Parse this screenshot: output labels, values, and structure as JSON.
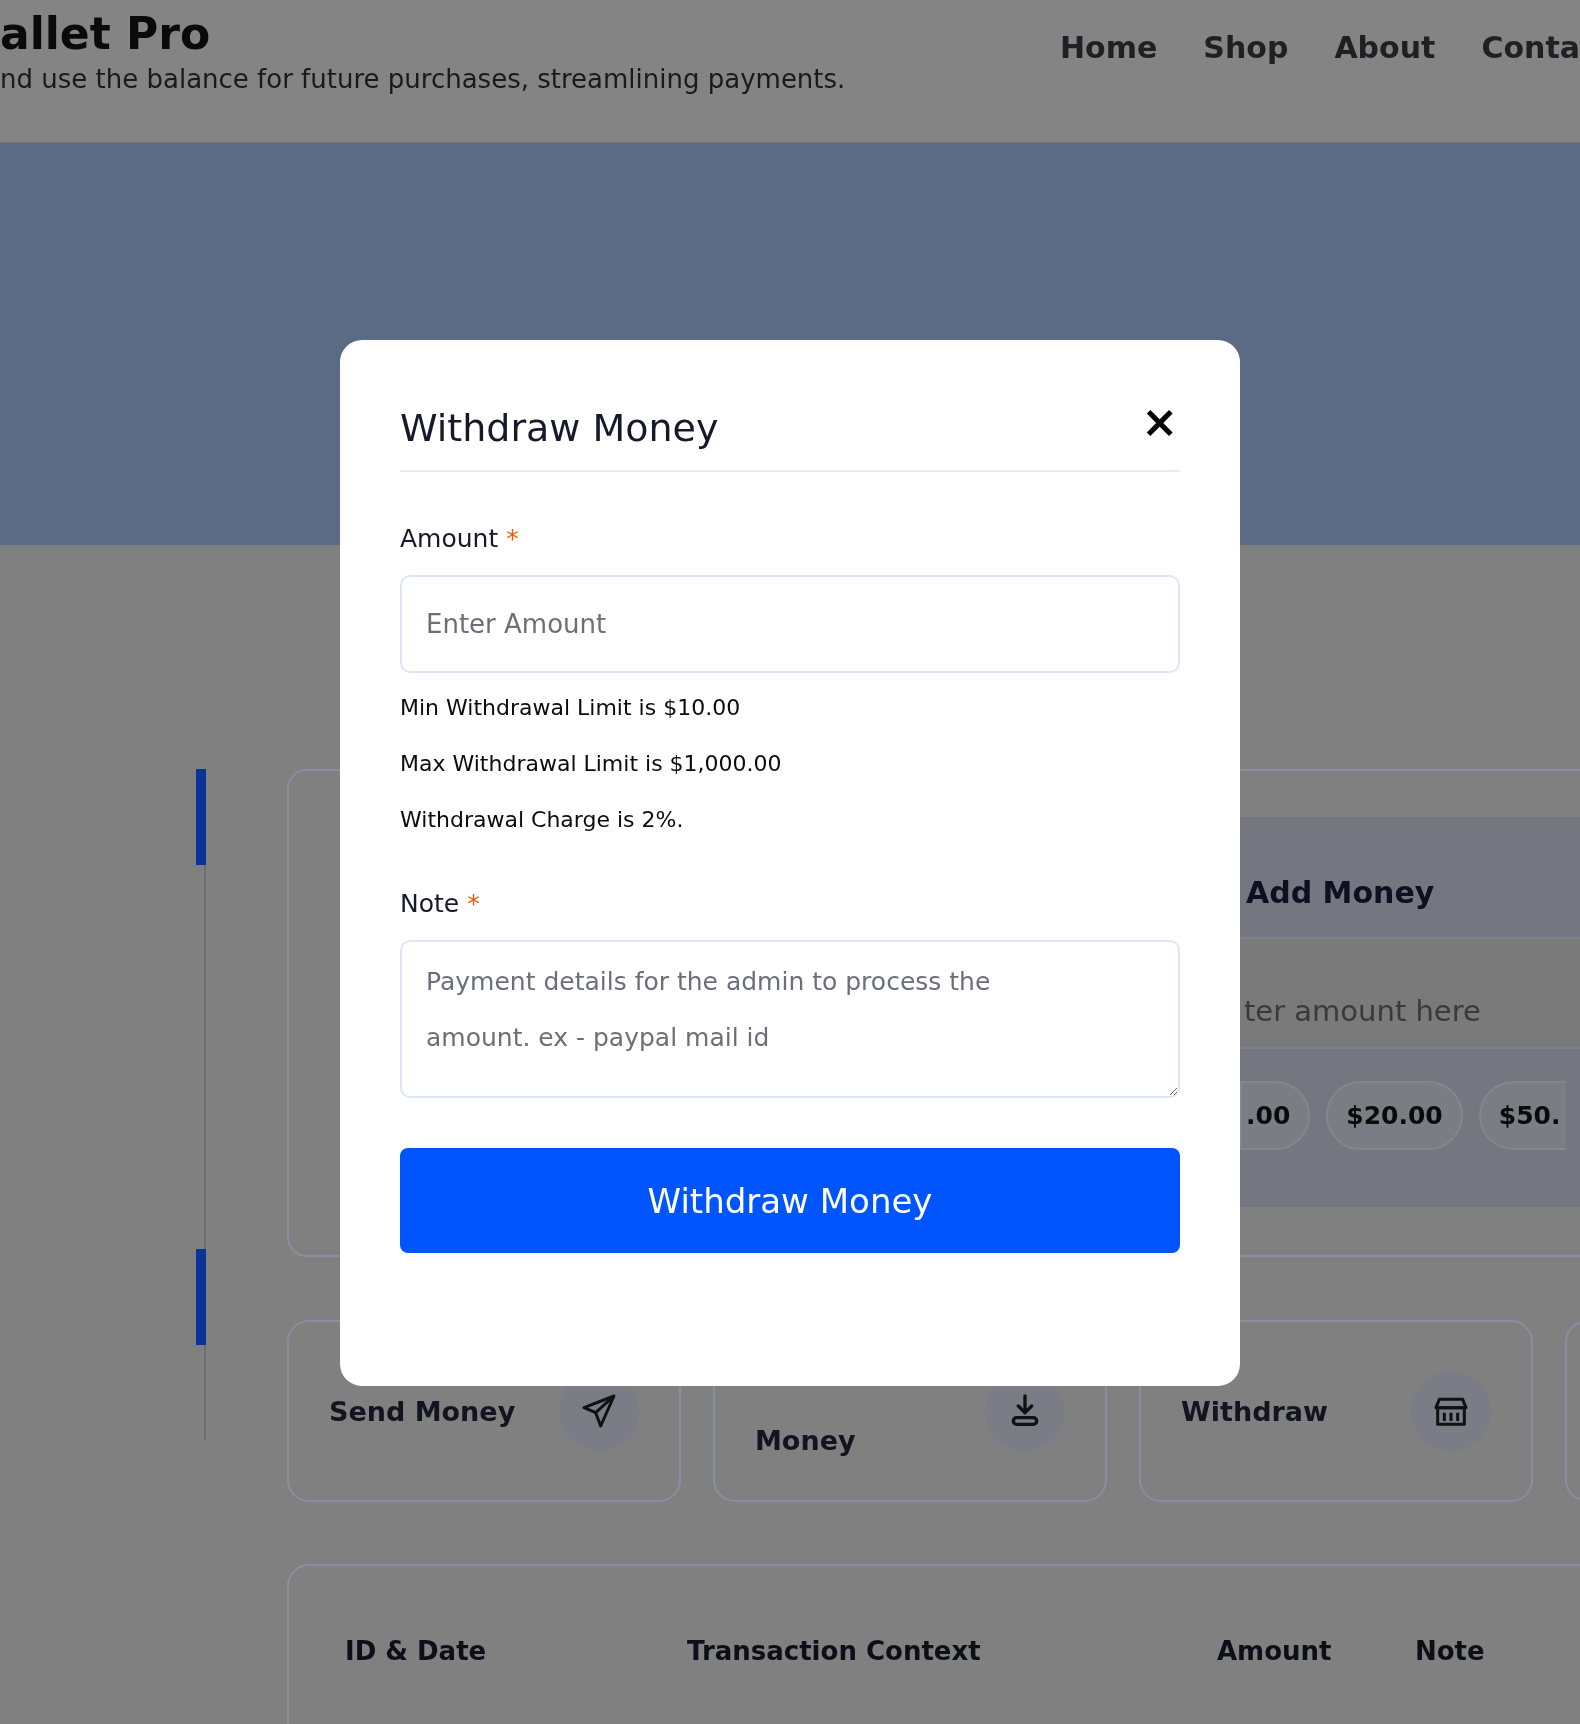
{
  "header": {
    "brand": "allet Pro",
    "tagline": "nd use the balance for future purchases, streamlining payments.",
    "nav": [
      "Home",
      "Shop",
      "About",
      "Conta"
    ]
  },
  "add_money": {
    "title": "Add Money",
    "placeholder": "ter amount here",
    "presets": [
      ".00",
      "$20.00",
      "$50."
    ]
  },
  "actions": [
    {
      "label": "Send Money",
      "kind": "send"
    },
    {
      "label": "Money",
      "kind": "download"
    },
    {
      "label": "Withdraw",
      "kind": "bank"
    }
  ],
  "transactions": {
    "columns": [
      "ID & Date",
      "Transaction Context",
      "Amount",
      "Note"
    ]
  },
  "modal": {
    "title": "Withdraw Money",
    "close": "×",
    "amount": {
      "label": "Amount",
      "required_mark": "*",
      "placeholder": "Enter Amount"
    },
    "limits": [
      "Min Withdrawal Limit is $10.00",
      "Max Withdrawal Limit is $1,000.00",
      "Withdrawal Charge is 2%."
    ],
    "note": {
      "label": "Note",
      "required_mark": "*",
      "placeholder": "Payment details for the admin to process the amount. ex - paypal mail id"
    },
    "submit": "Withdraw Money"
  }
}
